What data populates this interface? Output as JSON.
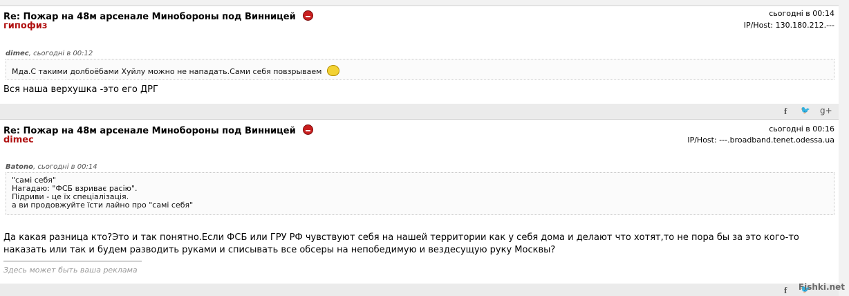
{
  "posts": [
    {
      "title": "Re: Пожар на 48м арсенале Минобороны под Винницей",
      "author": "гипофиз",
      "date": "сьогодні в 00:14",
      "ip": "IP/Host: 130.180.212.---",
      "quote_author": "dimec",
      "quote_date": ", сьогодні в 00:12",
      "quote_lines": [
        "Мда.С такими долбоёбами Хуйлу можно не нападать.Сами себя повзрываем"
      ],
      "body": [
        "Вся наша верхушка -это его ДРГ"
      ]
    },
    {
      "title": "Re: Пожар на 48м арсенале Минобороны под Винницей",
      "author": "dimec",
      "date": "сьогодні в 00:16",
      "ip": "IP/Host: ---.broadband.tenet.odessa.ua",
      "quote_author": "Batono",
      "quote_date": ", сьогодні в 00:14",
      "quote_lines": [
        "\"самі себя\"",
        "Нагадаю: \"ФСБ взриває расію\".",
        "Підриви - це їх спеціалізація.",
        "а ви продовжуйте їсти лайно про \"самі себя\""
      ],
      "body": [
        "Да какая разница кто?Это и так понятно.Если ФСБ или ГРУ РФ чувствуют себя на нашей территории как у себя дома и делают что хотят,то не пора бы за это кого-то",
        "наказать или так и будем разводить руками и списывать все обсеры на непобедимую и вездесущую руку Москвы?"
      ],
      "ad": "Здесь может быть ваша реклама"
    }
  ],
  "share": {
    "facebook": "f",
    "twitter": "🐦",
    "gplus": "g+"
  },
  "icons": {
    "mood": "angry-face-icon",
    "emoji": "facepalm-emoji-icon"
  },
  "watermark": "Fishki.net"
}
